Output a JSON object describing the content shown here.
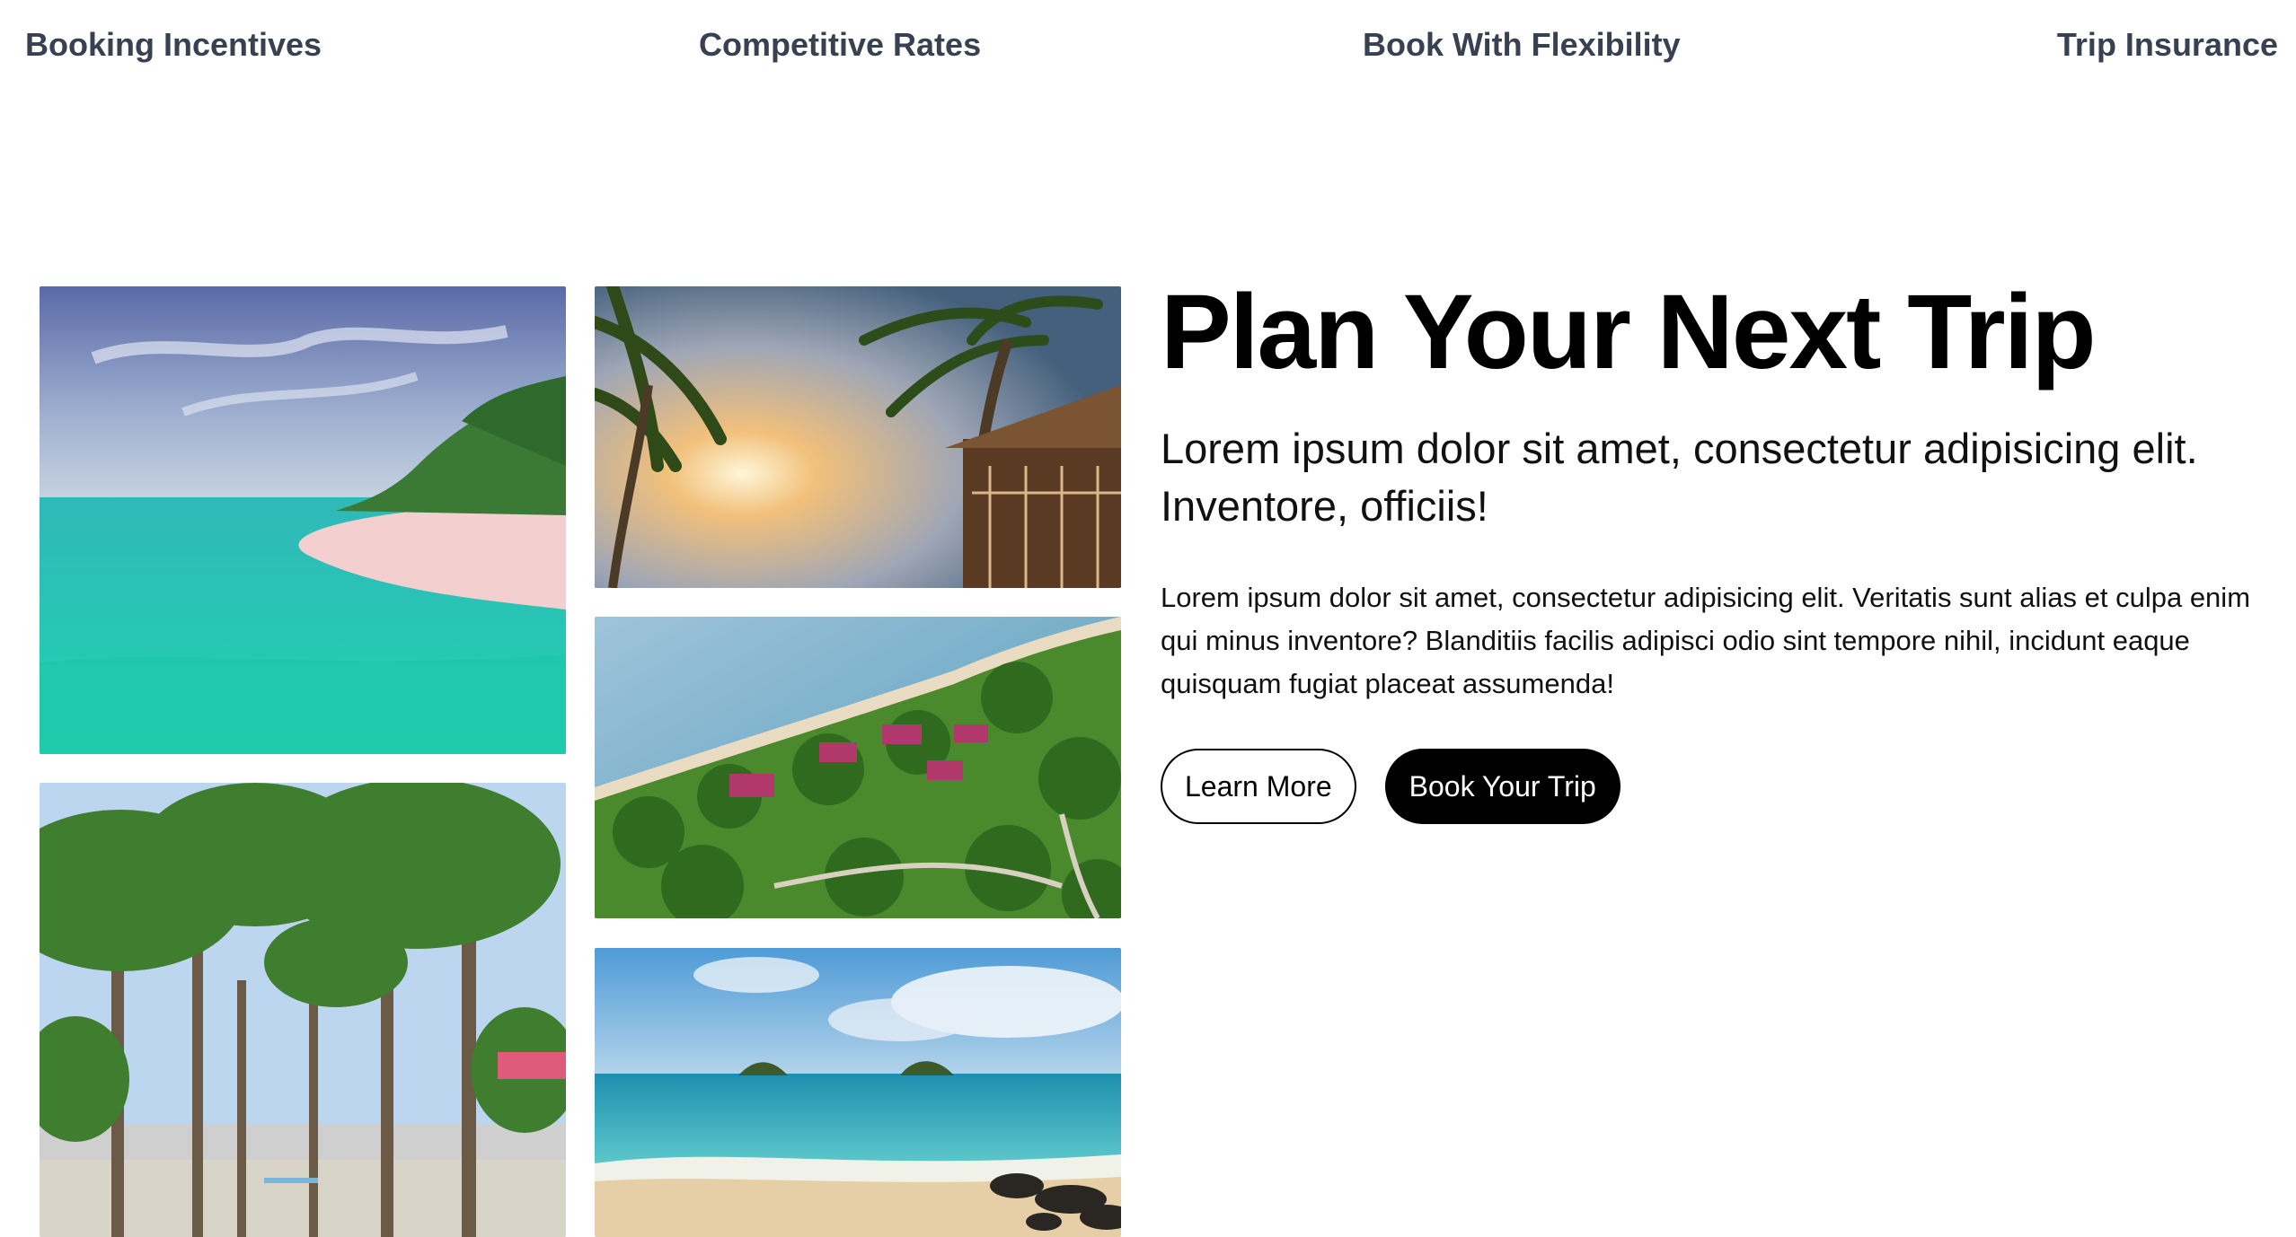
{
  "nav": {
    "items": [
      {
        "label": "Booking Incentives"
      },
      {
        "label": "Competitive Rates"
      },
      {
        "label": "Book With Flexibility"
      },
      {
        "label": "Trip Insurance"
      }
    ]
  },
  "gallery": {
    "images": [
      {
        "subject": "tropical-beach-turquoise-water"
      },
      {
        "subject": "palm-trees-sunset"
      },
      {
        "subject": "aerial-resort-coastline"
      },
      {
        "subject": "palm-tree-avenue"
      },
      {
        "subject": "beach-islands-horizon"
      }
    ]
  },
  "hero": {
    "title": "Plan Your Next Trip",
    "subtitle": "Lorem ipsum dolor sit amet, consectetur adipisicing elit. Inventore, officiis!",
    "body": "Lorem ipsum dolor sit amet, consectetur adipisicing elit. Veritatis sunt alias et culpa enim qui minus inventore? Blanditiis facilis adipisci odio sint tempore nihil, incidunt eaque quisquam fugiat placeat assumenda!",
    "primary_button": "Book Your Trip",
    "secondary_button": "Learn More"
  },
  "colors": {
    "nav_text": "#374151",
    "primary_button_bg": "#000000",
    "primary_button_text": "#ffffff",
    "secondary_button_border": "#000000"
  }
}
